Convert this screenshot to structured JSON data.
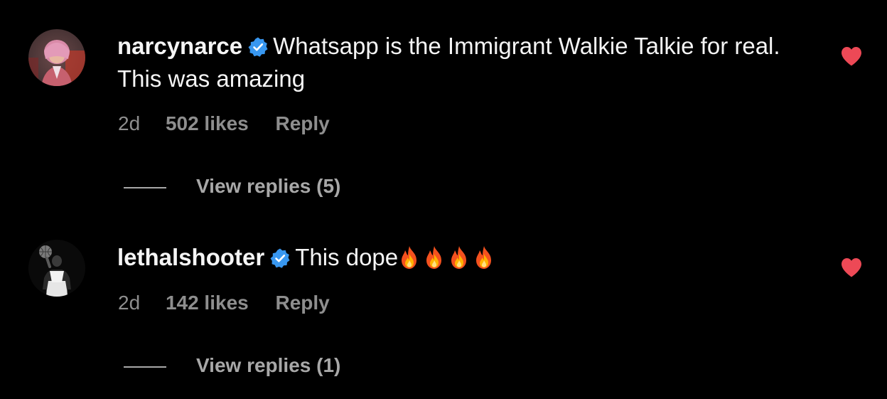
{
  "colors": {
    "background": "#000000",
    "text_primary": "#f5f5f5",
    "text_secondary": "#8e8e8e",
    "verified_badge": "#3897f0",
    "heart_liked": "#ed4956"
  },
  "comments": [
    {
      "username": "narcynarce",
      "verified": true,
      "text": "Whatsapp is the Immigrant Walkie Talkie for real. This was amazing",
      "time": "2d",
      "likes": "502 likes",
      "reply_label": "Reply",
      "view_replies": "View replies (5)",
      "liked": true,
      "avatar_icon": "avatar-person-pink-hood"
    },
    {
      "username": "lethalshooter",
      "verified": true,
      "text": "This dope",
      "emoji": [
        "fire",
        "fire",
        "fire",
        "fire"
      ],
      "time": "2d",
      "likes": "142 likes",
      "reply_label": "Reply",
      "view_replies": "View replies (1)",
      "liked": true,
      "avatar_icon": "avatar-person-basketball"
    }
  ]
}
